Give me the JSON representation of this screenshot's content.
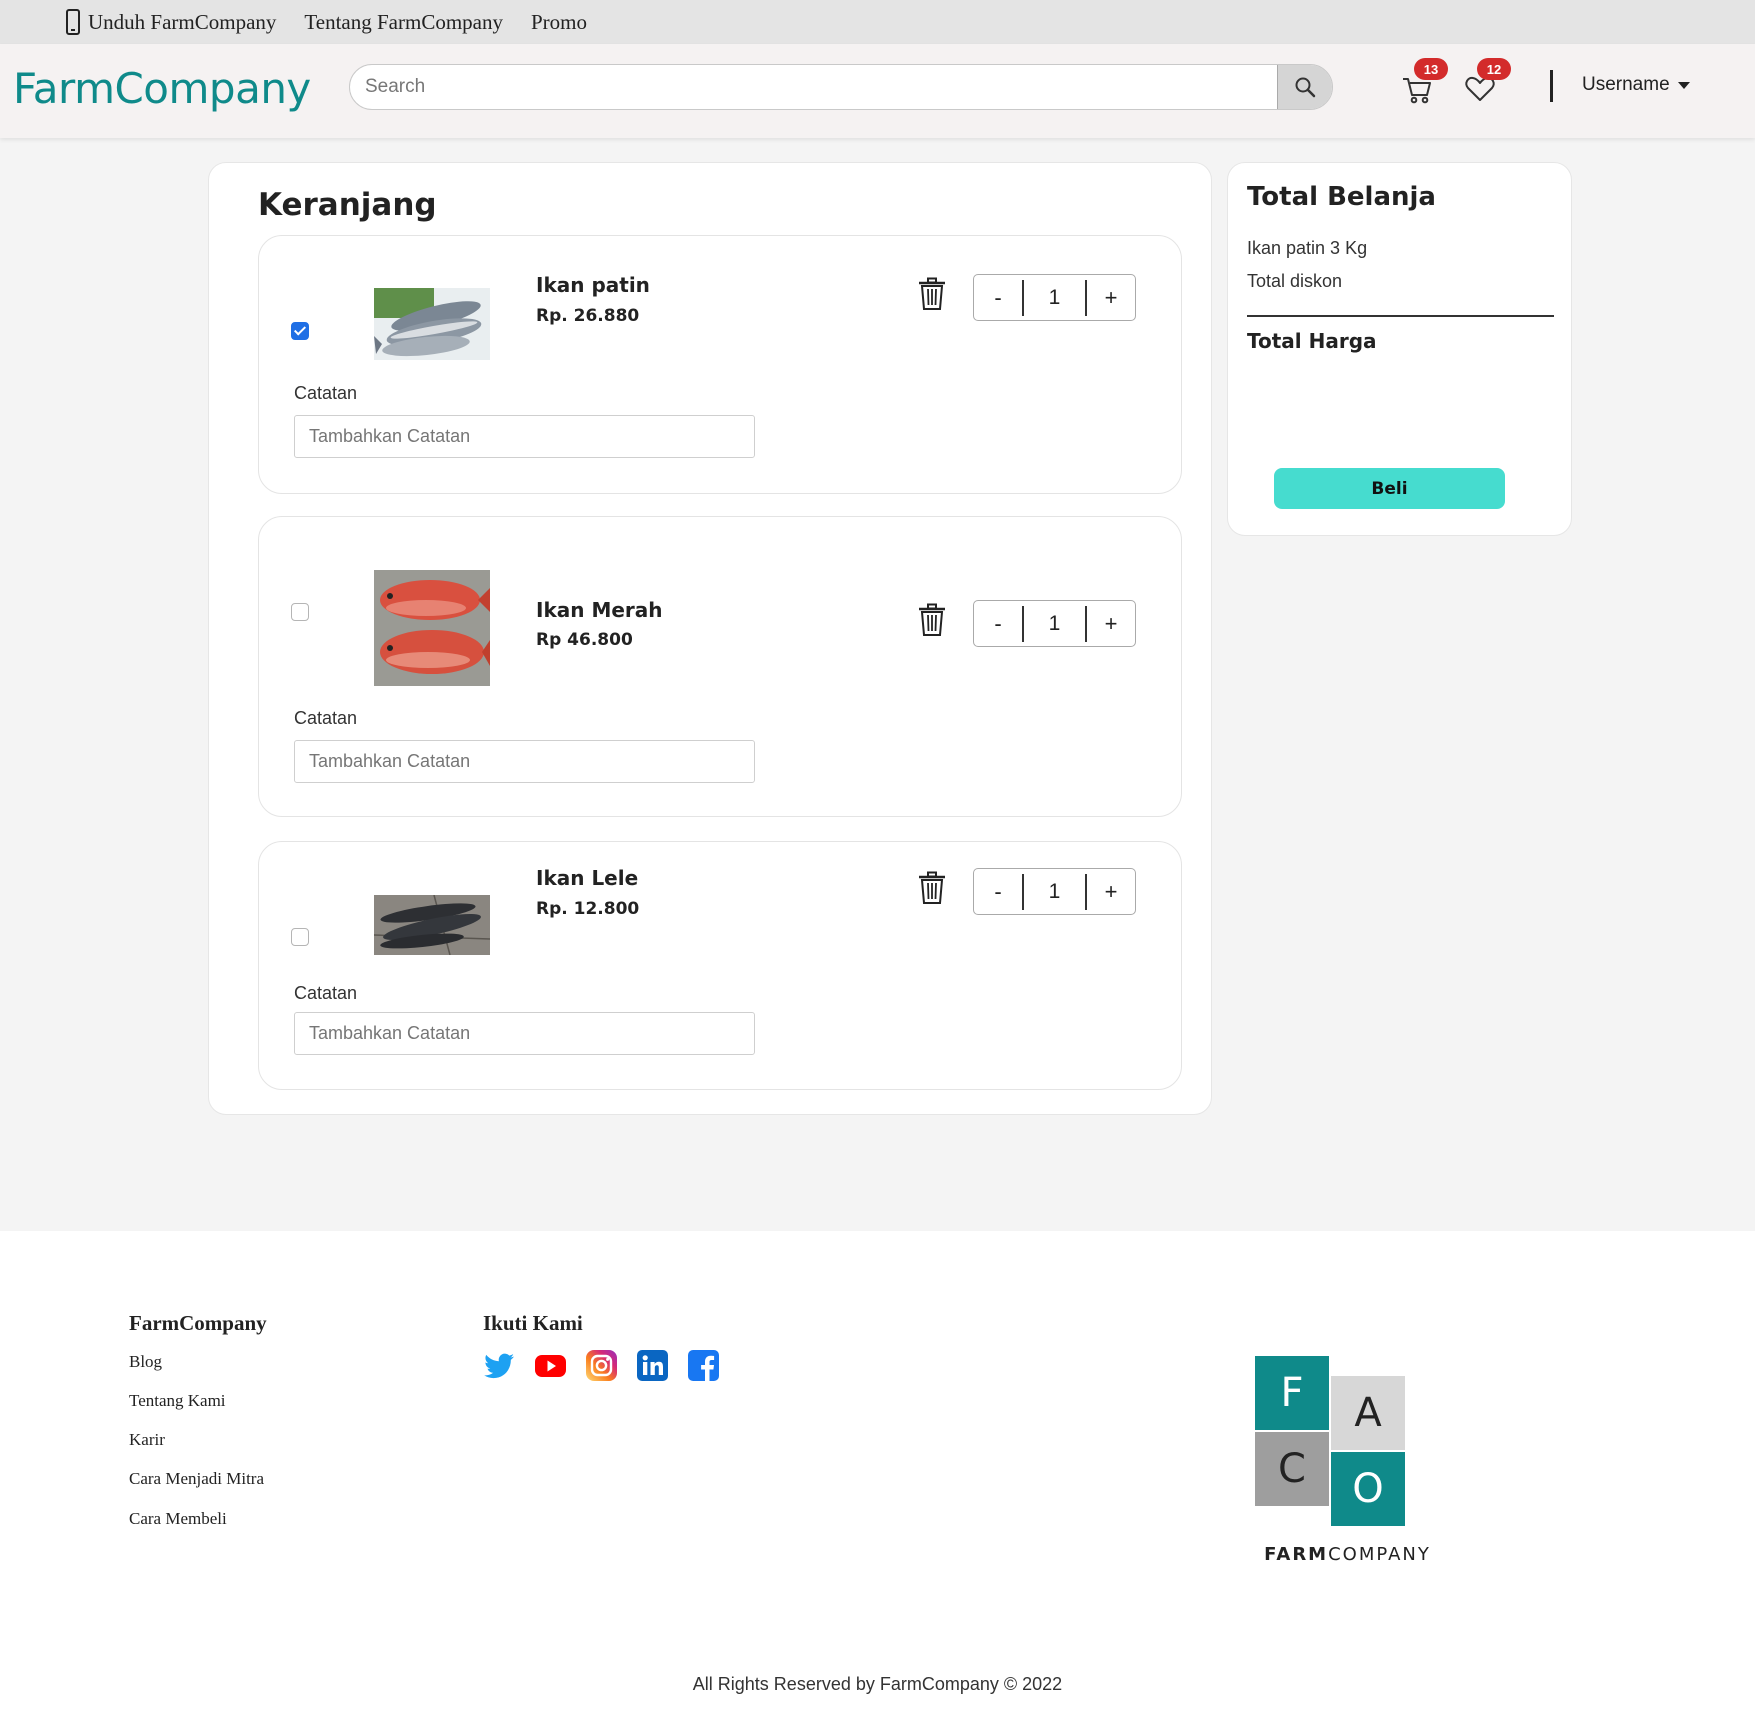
{
  "topbar": {
    "items": [
      "Unduh FarmCompany",
      "Tentang FarmCompany",
      "Promo"
    ]
  },
  "header": {
    "logo": "FarmCompany",
    "search_placeholder": "Search",
    "cart_count": "13",
    "wishlist_count": "12",
    "username": "Username"
  },
  "cart": {
    "title": "Keranjang",
    "note_label": "Catatan",
    "note_placeholder": "Tambahkan Catatan",
    "items": [
      {
        "name": "Ikan patin",
        "price": "Rp. 26.880",
        "qty": "1",
        "checked": true
      },
      {
        "name": "Ikan Merah",
        "price": "Rp 46.800",
        "qty": "1",
        "checked": false
      },
      {
        "name": "Ikan Lele",
        "price": "Rp. 12.800",
        "qty": "1",
        "checked": false
      }
    ],
    "minus": "-",
    "plus": "+"
  },
  "summary": {
    "title": "Total Belanja",
    "line1": "Ikan patin 3 Kg",
    "line2": "Total diskon",
    "total_label": "Total Harga",
    "buy": "Beli"
  },
  "footer": {
    "company_title": "FarmCompany",
    "links": [
      "Blog",
      "Tentang Kami",
      "Karir",
      "Cara Menjadi Mitra",
      "Cara Membeli"
    ],
    "follow_title": "Ikuti Kami",
    "social_icons": [
      "twitter-icon",
      "youtube-icon",
      "instagram-icon",
      "linkedin-icon",
      "facebook-icon"
    ],
    "logo_letters": [
      "F",
      "A",
      "C",
      "O"
    ],
    "logo_text_bold": "FARM",
    "logo_text": "COMPANY",
    "copyright": "All Rights Reserved by FarmCompany © 2022"
  },
  "colors": {
    "brand": "#0f8a8a",
    "buy_button": "#46dccf",
    "badge": "#d32b2b",
    "checkbox": "#1f6fe5"
  }
}
